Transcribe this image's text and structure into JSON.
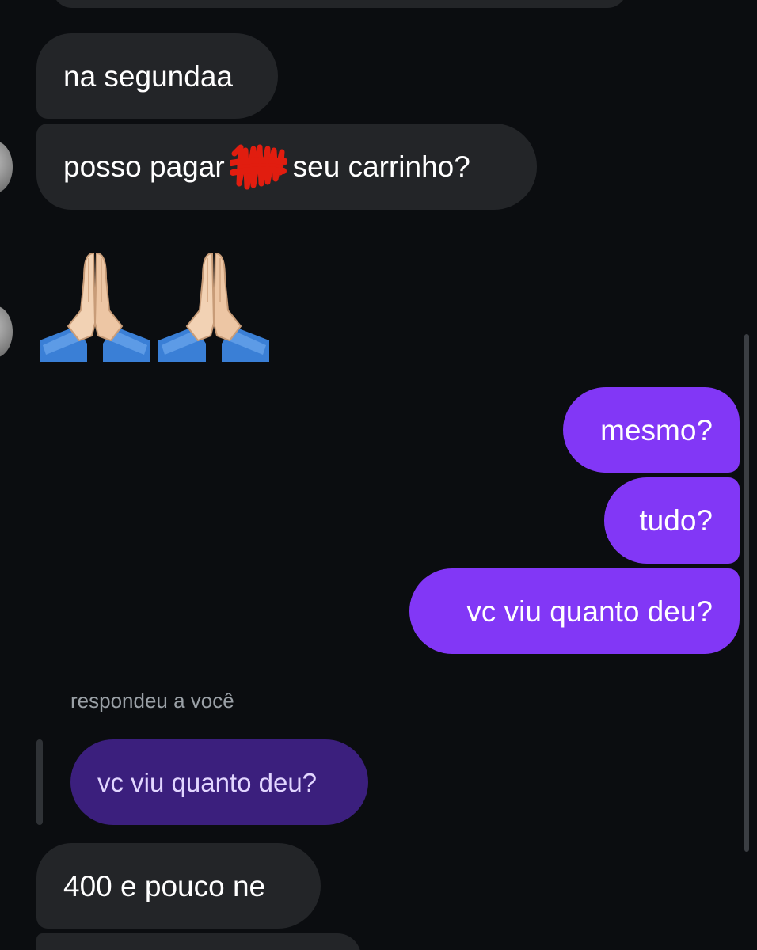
{
  "conversation": {
    "messages": [
      {
        "id": "m1",
        "direction": "incoming",
        "text": "na segundaa"
      },
      {
        "id": "m2",
        "direction": "incoming",
        "text_before": "posso pagar",
        "text_after": "seu carrinho?",
        "redacted": true
      },
      {
        "id": "m3",
        "direction": "incoming",
        "emoji": "🙏🙏",
        "emoji_name": "folded-hands-icon"
      },
      {
        "id": "m4",
        "direction": "outgoing",
        "text": "mesmo?"
      },
      {
        "id": "m5",
        "direction": "outgoing",
        "text": "tudo?"
      },
      {
        "id": "m6",
        "direction": "outgoing",
        "text": "vc viu quanto deu?"
      },
      {
        "id": "m7",
        "direction": "incoming",
        "reply_label": "respondeu a você",
        "quoted_text": "vc viu quanto deu?"
      },
      {
        "id": "m8",
        "direction": "incoming",
        "text": "400 e pouco ne"
      }
    ]
  },
  "colors": {
    "background": "#0b0d10",
    "incoming_bubble": "#232528",
    "outgoing_bubble": "#8237f6",
    "quoted_bubble": "#3b1f7d",
    "redaction": "#e11d0f"
  }
}
